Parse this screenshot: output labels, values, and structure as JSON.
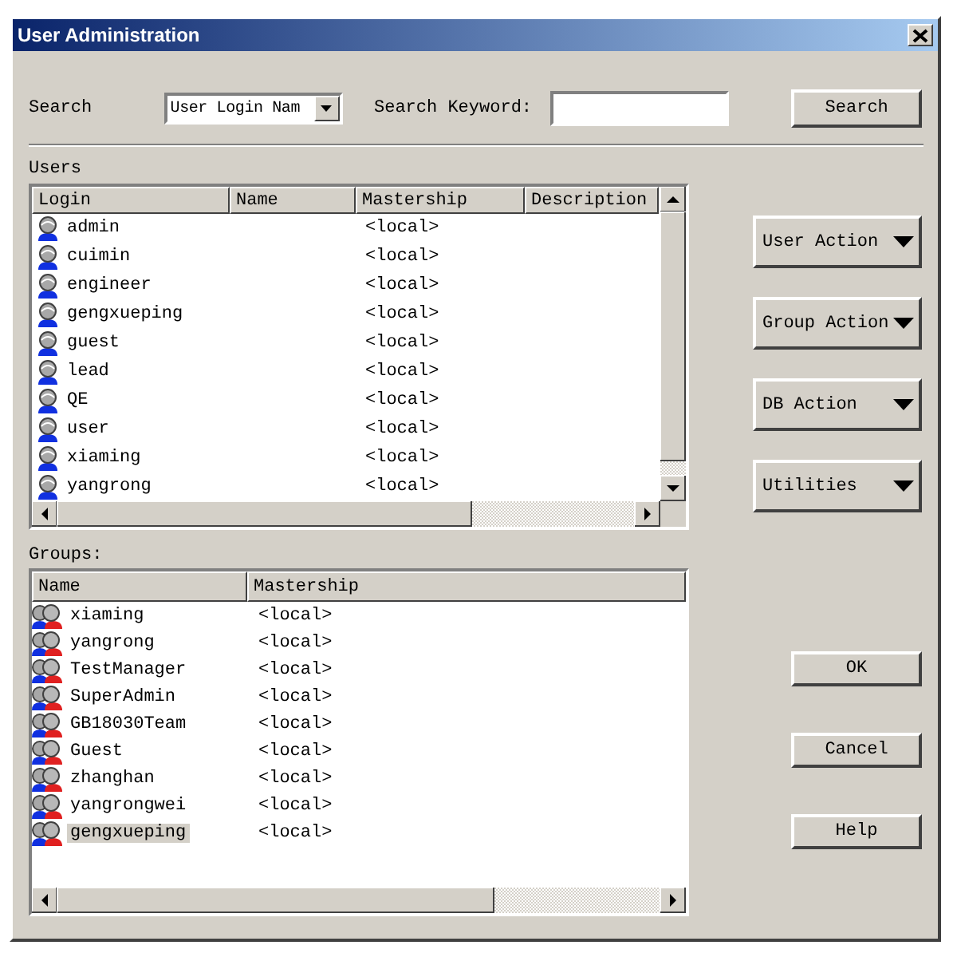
{
  "window": {
    "title": "User Administration"
  },
  "search": {
    "label": "Search",
    "scope": "User Login Nam",
    "keyword_label": "Search Keyword:",
    "button": "Search"
  },
  "users": {
    "label": "Users",
    "columns": [
      "Login",
      "Name",
      "Mastership",
      "Description"
    ],
    "rows": [
      {
        "login": "admin",
        "mastership": "<local>",
        "selected": false
      },
      {
        "login": "cuimin",
        "mastership": "<local>",
        "selected": false
      },
      {
        "login": "engineer",
        "mastership": "<local>",
        "selected": false
      },
      {
        "login": "gengxueping",
        "mastership": "<local>",
        "selected": false
      },
      {
        "login": "guest",
        "mastership": "<local>",
        "selected": false
      },
      {
        "login": "lead",
        "mastership": "<local>",
        "selected": false
      },
      {
        "login": "QE",
        "mastership": "<local>",
        "selected": false
      },
      {
        "login": "user",
        "mastership": "<local>",
        "selected": false
      },
      {
        "login": "xiaming",
        "mastership": "<local>",
        "selected": false
      },
      {
        "login": "yangrong",
        "mastership": "<local>",
        "selected": false
      }
    ]
  },
  "groups": {
    "label": "Groups:",
    "columns": [
      "Name",
      "Mastership"
    ],
    "rows": [
      {
        "name": "xiaming",
        "mastership": "<local>",
        "selected": false
      },
      {
        "name": "yangrong",
        "mastership": "<local>",
        "selected": false
      },
      {
        "name": "TestManager",
        "mastership": "<local>",
        "selected": false
      },
      {
        "name": "SuperAdmin",
        "mastership": "<local>",
        "selected": false
      },
      {
        "name": "GB18030Team",
        "mastership": "<local>",
        "selected": false
      },
      {
        "name": "Guest",
        "mastership": "<local>",
        "selected": false
      },
      {
        "name": "zhanghan",
        "mastership": "<local>",
        "selected": false
      },
      {
        "name": "yangrongwei",
        "mastership": "<local>",
        "selected": false
      },
      {
        "name": "gengxueping",
        "mastership": "<local>",
        "selected": true
      }
    ]
  },
  "action_buttons": [
    "User Action",
    "Group Action",
    "DB Action",
    "Utilities"
  ],
  "dialog_buttons": [
    "OK",
    "Cancel",
    "Help"
  ]
}
